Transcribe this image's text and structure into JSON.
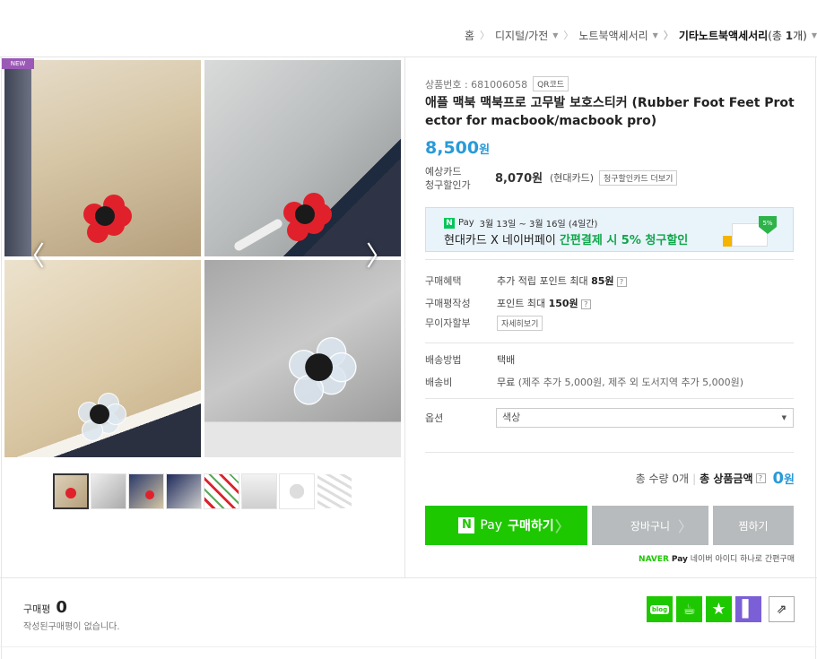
{
  "breadcrumb": {
    "items": [
      {
        "label": "홈",
        "dropdown": false
      },
      {
        "label": "디지털/가전",
        "dropdown": true
      },
      {
        "label": "노트북액세서리",
        "dropdown": true
      },
      {
        "label": "기타노트북액세서리",
        "dropdown": true
      }
    ],
    "count_prefix": "(총 ",
    "count_value": "1",
    "count_suffix": "개)"
  },
  "gallery": {
    "badge": "NEW",
    "thumbnail_count": 8
  },
  "product": {
    "number_label": "상품번호 : 681006058",
    "qr_label": "QR코드",
    "title": "애플 맥북 맥북프로 고무발 보호스티커 (Rubber Foot Feet Protector for macbook/macbook pro)",
    "price": "8,500",
    "price_unit": "원",
    "est_label_1": "예상카드",
    "est_label_2": "청구할인가",
    "est_price": "8,070원",
    "est_card": "(현대카드)",
    "card_more": "청구할인카드 더보기"
  },
  "banner": {
    "npay": "N",
    "pay": "Pay",
    "period": "3월 13일 ~ 3월 16일 (4일간)",
    "text_prefix": "현대카드 X 네이버페이 ",
    "text_highlight": "간편결제 시 5% 청구할인",
    "badge": "5%"
  },
  "benefits": {
    "purchase_label": "구매혜택",
    "purchase_text": "추가 적립 포인트 최대 ",
    "purchase_value": "85원",
    "review_label": "구매평작성",
    "review_text": "포인트 최대 ",
    "review_value": "150원",
    "installment_label": "무이자할부",
    "installment_btn": "자세히보기"
  },
  "shipping": {
    "method_label": "배송방법",
    "method_value": "택배",
    "fee_label": "배송비",
    "fee_value": "무료",
    "fee_note": "(제주 추가 5,000원, 제주 외 도서지역 추가 5,000원)"
  },
  "option": {
    "label": "옵션",
    "selected": "색상"
  },
  "total": {
    "qty_text": "총 수량 0개",
    "label": "총 상품금액",
    "amount": "0",
    "unit": "원"
  },
  "actions": {
    "buy_n": "N",
    "buy_pay": "Pay",
    "buy_label": "구매하기",
    "cart_label": "장바구니",
    "wish_label": "찜하기",
    "note_naver": "NAVER",
    "note_pay": "Pay",
    "note_text": "네이버 아이디 하나로 간편구매"
  },
  "review": {
    "label": "구매평",
    "count": "0",
    "empty": "작성된구매평이 없습니다."
  },
  "share": {
    "blog": "blog",
    "icons": [
      "blog-icon",
      "cafe-icon",
      "star-icon",
      "post-icon",
      "share-icon"
    ]
  },
  "colors": {
    "price_blue": "#2a9ad8",
    "naver_green": "#1ec800",
    "button_gray": "#b7bbbd",
    "badge_purple": "#9b59b6"
  }
}
